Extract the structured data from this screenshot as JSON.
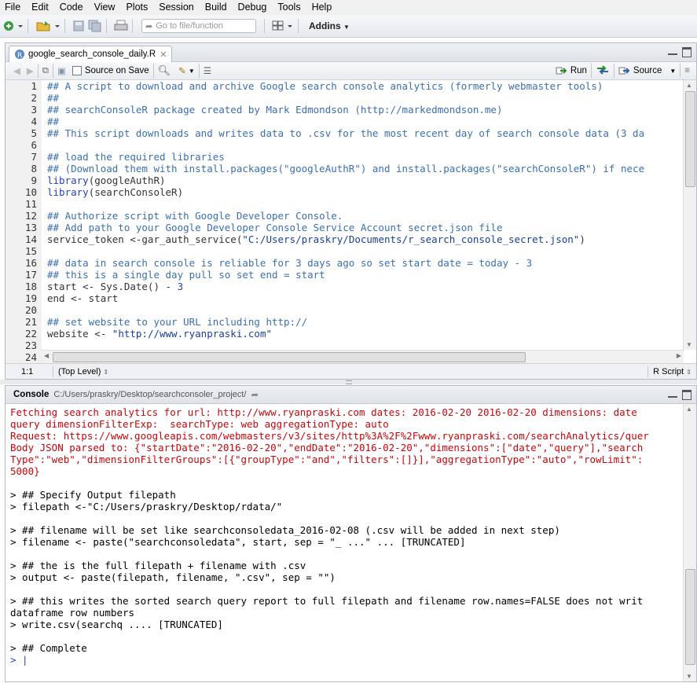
{
  "menu": [
    "File",
    "Edit",
    "Code",
    "View",
    "Plots",
    "Session",
    "Build",
    "Debug",
    "Tools",
    "Help"
  ],
  "toolbar": {
    "goto_placeholder": "Go to file/function",
    "addins_label": "Addins"
  },
  "editor": {
    "tab_label": "google_search_console_daily.R",
    "source_on_save": "Source on Save",
    "run_label": "Run",
    "source_label": "Source",
    "lines": [
      {
        "n": "1",
        "segs": [
          {
            "c": "cmt",
            "t": "## A script to download and archive Google search console analytics (formerly webmaster tools)"
          }
        ]
      },
      {
        "n": "2",
        "segs": [
          {
            "c": "cmt",
            "t": "##"
          }
        ]
      },
      {
        "n": "3",
        "segs": [
          {
            "c": "cmt",
            "t": "## searchConsoleR package created by Mark Edmondson (http://markedmondson.me)"
          }
        ]
      },
      {
        "n": "4",
        "segs": [
          {
            "c": "cmt",
            "t": "##"
          }
        ]
      },
      {
        "n": "5",
        "segs": [
          {
            "c": "cmt",
            "t": "## This script downloads and writes data to .csv for the most recent day of search console data (3 da"
          }
        ]
      },
      {
        "n": "6",
        "segs": []
      },
      {
        "n": "7",
        "segs": [
          {
            "c": "cmt",
            "t": "## load the required libraries"
          }
        ]
      },
      {
        "n": "8",
        "segs": [
          {
            "c": "cmt",
            "t": "## (Download them with install.packages(\"googleAuthR\") and install.packages(\"searchConsoleR\") if nece"
          }
        ]
      },
      {
        "n": "9",
        "segs": [
          {
            "c": "kw",
            "t": "library"
          },
          {
            "c": "op",
            "t": "(googleAuthR)"
          }
        ]
      },
      {
        "n": "10",
        "segs": [
          {
            "c": "kw",
            "t": "library"
          },
          {
            "c": "op",
            "t": "(searchConsoleR)"
          }
        ]
      },
      {
        "n": "11",
        "segs": []
      },
      {
        "n": "12",
        "segs": [
          {
            "c": "cmt",
            "t": "## Authorize script with Google Developer Console."
          }
        ]
      },
      {
        "n": "13",
        "segs": [
          {
            "c": "cmt",
            "t": "## Add path to your Google Developer Console Service Account secret.json file"
          }
        ]
      },
      {
        "n": "14",
        "segs": [
          {
            "c": "op",
            "t": "service_token <-gar_auth_service("
          },
          {
            "c": "str",
            "t": "\"C:/Users/praskry/Documents/r_search_console_secret.json\""
          },
          {
            "c": "op",
            "t": ")"
          }
        ]
      },
      {
        "n": "15",
        "segs": []
      },
      {
        "n": "16",
        "segs": [
          {
            "c": "cmt",
            "t": "## data in search console is reliable for 3 days ago so set start date = today - 3"
          }
        ]
      },
      {
        "n": "17",
        "segs": [
          {
            "c": "cmt",
            "t": "## this is a single day pull so set end = start"
          }
        ]
      },
      {
        "n": "18",
        "segs": [
          {
            "c": "op",
            "t": "start <- Sys.Date() - "
          },
          {
            "c": "num",
            "t": "3"
          }
        ]
      },
      {
        "n": "19",
        "segs": [
          {
            "c": "op",
            "t": "end <- start"
          }
        ]
      },
      {
        "n": "20",
        "segs": []
      },
      {
        "n": "21",
        "segs": [
          {
            "c": "cmt",
            "t": "## set website to your URL including http://"
          }
        ]
      },
      {
        "n": "22",
        "segs": [
          {
            "c": "op",
            "t": "website <- "
          },
          {
            "c": "str",
            "t": "\"http://www.ryanpraski.com\""
          }
        ]
      },
      {
        "n": "23",
        "segs": []
      },
      {
        "n": "24",
        "segs": []
      }
    ],
    "status_pos": "1:1",
    "status_scope": "(Top Level)",
    "status_type": "R Script"
  },
  "console": {
    "title": "Console",
    "path": "C:/Users/praskry/Desktop/searchconsoler_project/",
    "lines": [
      {
        "c": "red",
        "t": "Fetching search analytics for url: http://www.ryanpraski.com dates: 2016-02-20 2016-02-20 dimensions: date"
      },
      {
        "c": "red",
        "t": "query dimensionFilterExp:  searchType: web aggregationType: auto"
      },
      {
        "c": "red",
        "t": "Request: https://www.googleapis.com/webmasters/v3/sites/http%3A%2F%2Fwww.ryanpraski.com/searchAnalytics/quer"
      },
      {
        "c": "red",
        "t": "Body JSON parsed to: {\"startDate\":\"2016-02-20\",\"endDate\":\"2016-02-20\",\"dimensions\":[\"date\",\"query\"],\"search"
      },
      {
        "c": "red",
        "t": "Type\":\"web\",\"dimensionFilterGroups\":[{\"groupType\":\"and\",\"filters\":[]}],\"aggregationType\":\"auto\",\"rowLimit\":"
      },
      {
        "c": "red",
        "t": "5000}"
      },
      {
        "c": "blk",
        "t": ""
      },
      {
        "c": "blk",
        "t": "> ## Specify Output filepath"
      },
      {
        "c": "blk",
        "t": "> filepath <-\"C:/Users/praskry/Desktop/rdata/\""
      },
      {
        "c": "blk",
        "t": ""
      },
      {
        "c": "blk",
        "t": "> ## filename will be set like searchconsoledata_2016-02-08 (.csv will be added in next step)"
      },
      {
        "c": "blk",
        "t": "> filename <- paste(\"searchconsoledata\", start, sep = \"_ ...\" ... [TRUNCATED]"
      },
      {
        "c": "blk",
        "t": ""
      },
      {
        "c": "blk",
        "t": "> ## the is the full filepath + filename with .csv"
      },
      {
        "c": "blk",
        "t": "> output <- paste(filepath, filename, \".csv\", sep = \"\")"
      },
      {
        "c": "blk",
        "t": ""
      },
      {
        "c": "blk",
        "t": "> ## this writes the sorted search query report to full filepath and filename row.names=FALSE does not writ"
      },
      {
        "c": "blk",
        "t": "dataframe row numbers"
      },
      {
        "c": "blk",
        "t": "> write.csv(searchq .... [TRUNCATED]"
      },
      {
        "c": "blk",
        "t": ""
      },
      {
        "c": "blk",
        "t": "> ## Complete"
      },
      {
        "c": "blue",
        "t": "> |"
      }
    ]
  }
}
